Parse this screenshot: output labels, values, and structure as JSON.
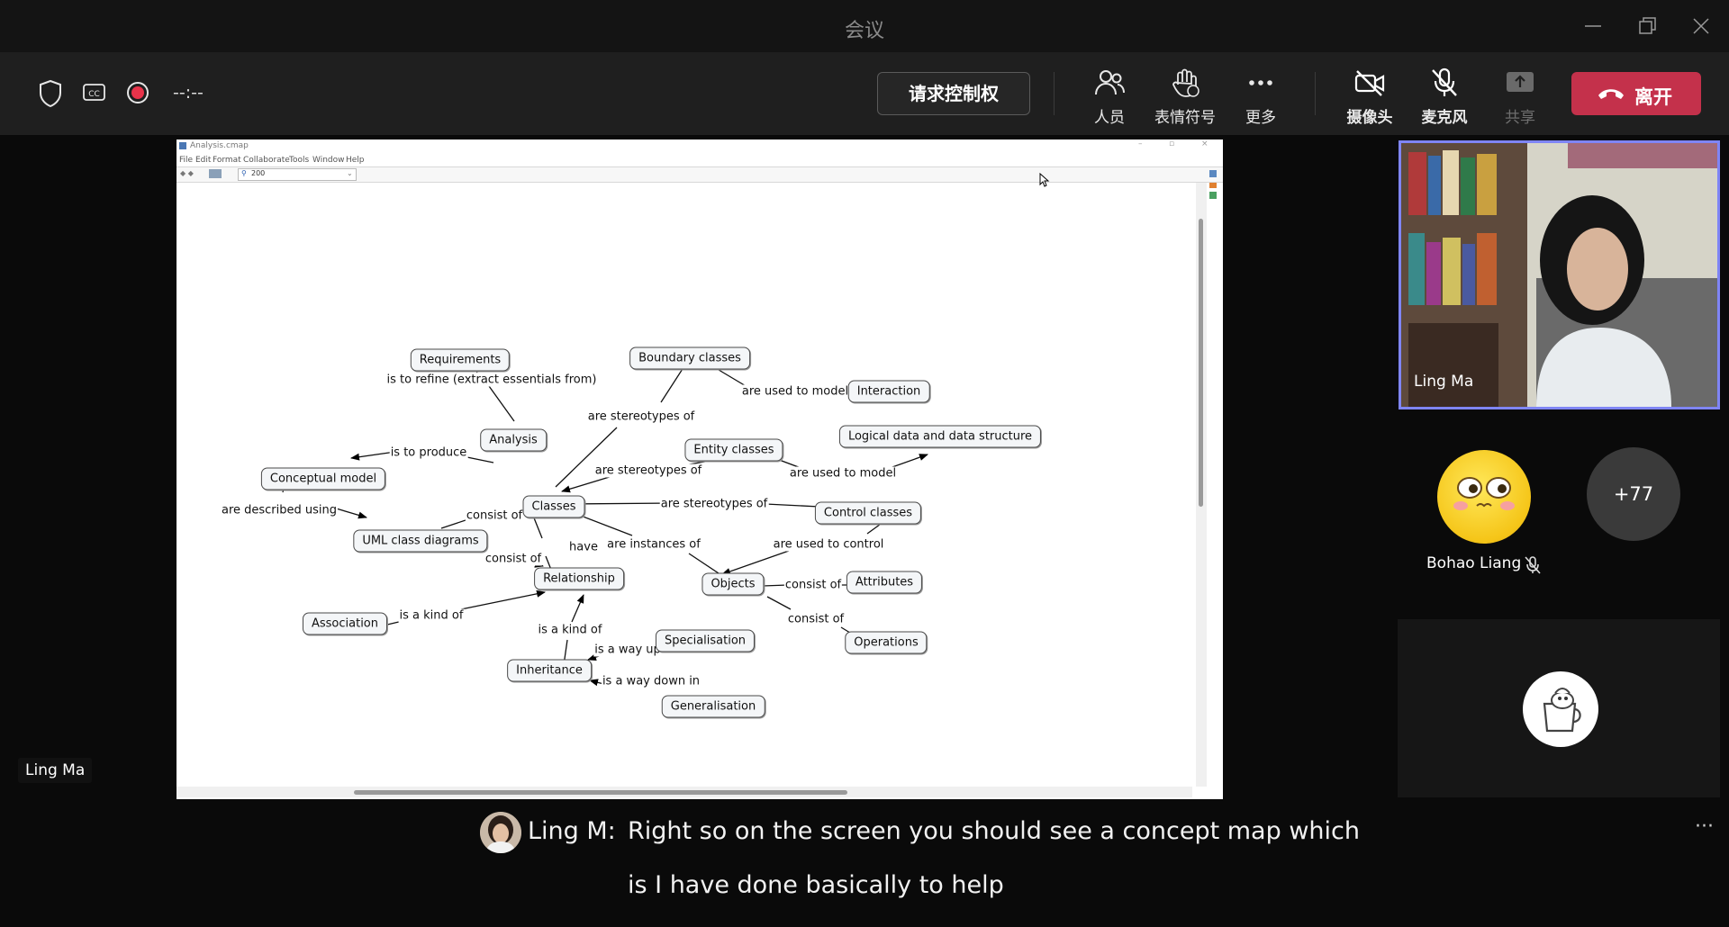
{
  "window": {
    "title": "会议",
    "minimize_icon": "minimize-icon",
    "restore_icon": "restore-icon",
    "close_icon": "close-icon"
  },
  "toolbar": {
    "timer": "--:--",
    "request_control": "请求控制权",
    "people": "人员",
    "reactions": "表情符号",
    "more": "更多",
    "camera": "摄像头",
    "mic": "麦克风",
    "share": "共享",
    "leave": "离开",
    "leave_color": "#c4314b"
  },
  "shared_screen": {
    "app_title": "Analysis.cmap",
    "menu": [
      "File",
      "Edit",
      "Format",
      "Collaborate",
      "Tools",
      "Window",
      "Help"
    ],
    "zoom": "200",
    "nodes": [
      {
        "id": "requirements",
        "label": "Requirements"
      },
      {
        "id": "boundary",
        "label": "Boundary classes"
      },
      {
        "id": "interaction",
        "label": "Interaction"
      },
      {
        "id": "analysis",
        "label": "Analysis"
      },
      {
        "id": "entity",
        "label": "Entity classes"
      },
      {
        "id": "logical",
        "label": "Logical data and data structure"
      },
      {
        "id": "conceptual",
        "label": "Conceptual model"
      },
      {
        "id": "classes",
        "label": "Classes"
      },
      {
        "id": "control",
        "label": "Control classes"
      },
      {
        "id": "uml",
        "label": "UML class diagrams"
      },
      {
        "id": "relationship",
        "label": "Relationship"
      },
      {
        "id": "objects",
        "label": "Objects"
      },
      {
        "id": "attributes",
        "label": "Attributes"
      },
      {
        "id": "association",
        "label": "Association"
      },
      {
        "id": "specialisation",
        "label": "Specialisation"
      },
      {
        "id": "operations",
        "label": "Operations"
      },
      {
        "id": "inheritance",
        "label": "Inheritance"
      },
      {
        "id": "generalisation",
        "label": "Generalisation"
      }
    ],
    "links": [
      {
        "id": "l1",
        "label": "is to refine (extract essentials from)"
      },
      {
        "id": "l2",
        "label": "are used to model"
      },
      {
        "id": "l3",
        "label": "are stereotypes of"
      },
      {
        "id": "l4",
        "label": "is to produce"
      },
      {
        "id": "l5",
        "label": "are stereotypes of"
      },
      {
        "id": "l6",
        "label": "are used to model"
      },
      {
        "id": "l7",
        "label": "are described using"
      },
      {
        "id": "l8",
        "label": "consist of"
      },
      {
        "id": "l9",
        "label": "are stereotypes of"
      },
      {
        "id": "l10",
        "label": "have"
      },
      {
        "id": "l11",
        "label": "are instances of"
      },
      {
        "id": "l12",
        "label": "are used to control"
      },
      {
        "id": "l13",
        "label": "consist of"
      },
      {
        "id": "l14",
        "label": "consist of"
      },
      {
        "id": "l15",
        "label": "is a kind of"
      },
      {
        "id": "l16",
        "label": "is a kind of"
      },
      {
        "id": "l17",
        "label": "consist of"
      },
      {
        "id": "l18",
        "label": "is a way up in"
      },
      {
        "id": "l19",
        "label": "is a way down in"
      }
    ]
  },
  "participants": {
    "presenter_name": "Ling Ma",
    "video_tile_name": "Ling Ma",
    "bohao": "Bohao Liang",
    "more_count": "+77"
  },
  "captions": {
    "speaker": "Ling M:",
    "line1": "Right so on the screen you should see a concept map which",
    "line2": "is I have done basically to help"
  }
}
